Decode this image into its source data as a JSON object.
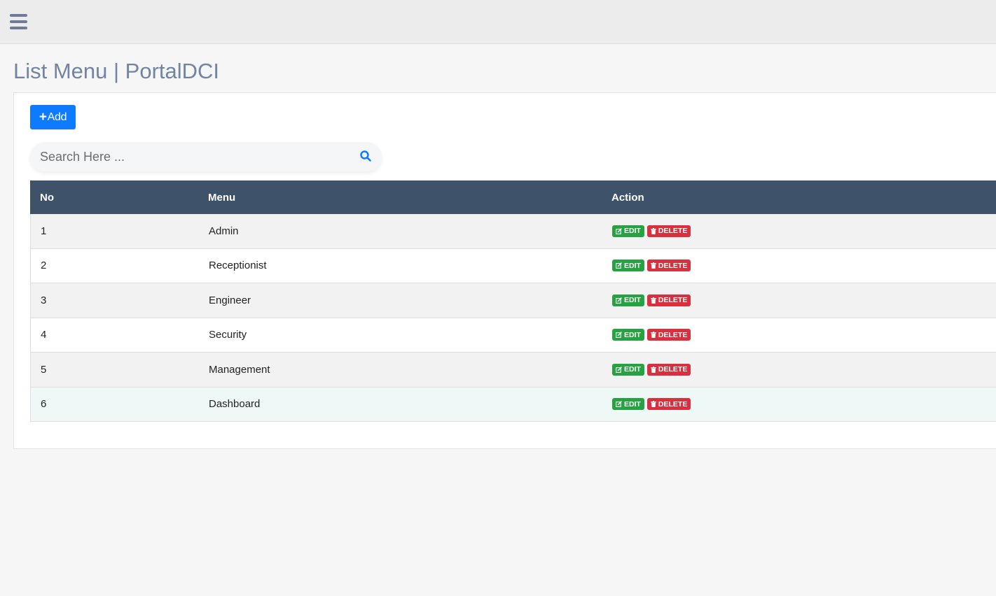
{
  "page": {
    "title": "List Menu | PortalDCI"
  },
  "toolbar": {
    "add_label": "Add",
    "add_icon": "plus-icon"
  },
  "search": {
    "placeholder": "Search Here ...",
    "value": "",
    "icon": "search-icon"
  },
  "table": {
    "headers": {
      "no": "No",
      "menu": "Menu",
      "action": "Action"
    },
    "rows": [
      {
        "no": "1",
        "menu": "Admin"
      },
      {
        "no": "2",
        "menu": "Receptionist"
      },
      {
        "no": "3",
        "menu": "Engineer"
      },
      {
        "no": "4",
        "menu": "Security"
      },
      {
        "no": "5",
        "menu": "Management"
      },
      {
        "no": "6",
        "menu": "Dashboard"
      }
    ],
    "edit_label": "EDIT",
    "delete_label": "DELETE"
  },
  "colors": {
    "header_bg": "#3e526a",
    "primary": "#0d7bff",
    "edit": "#27a243",
    "delete": "#d9303f",
    "title": "#7185a3"
  }
}
